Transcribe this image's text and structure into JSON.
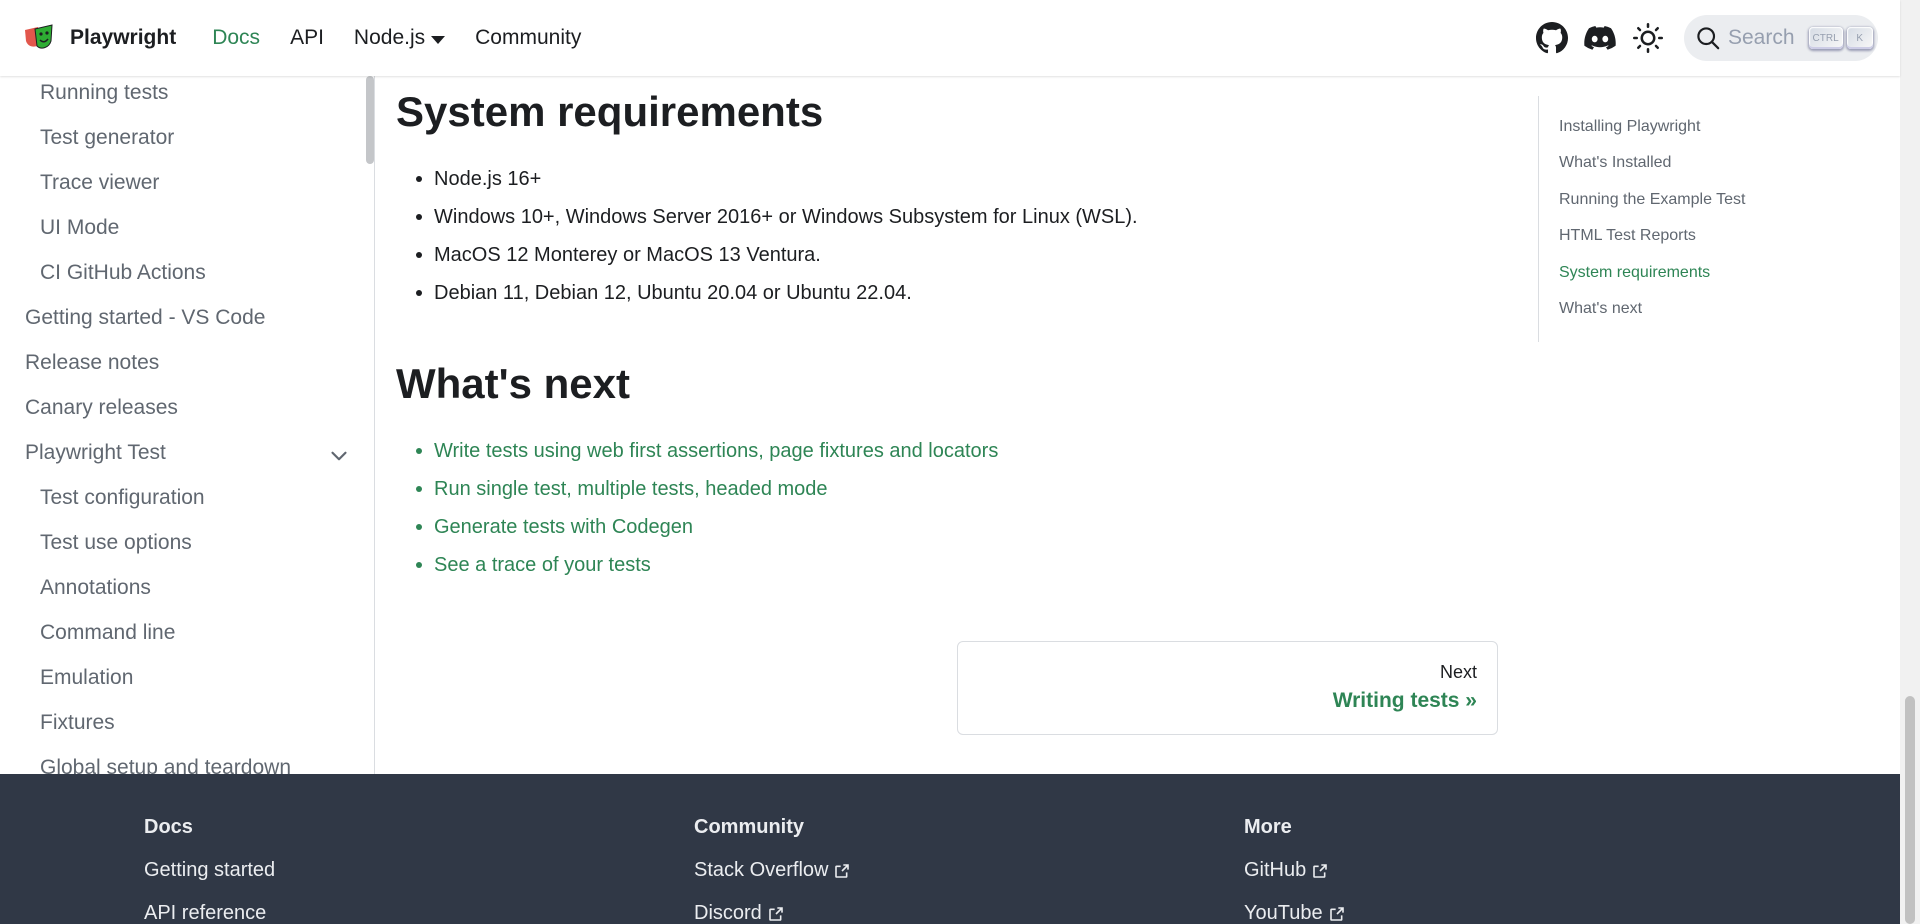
{
  "navbar": {
    "brand": "Playwright",
    "links": [
      "Docs",
      "API",
      "Node.js",
      "Community"
    ],
    "search_placeholder": "Search",
    "kbd_ctrl": "CTRL",
    "kbd_k": "K"
  },
  "sidebar": {
    "items": [
      "Running tests",
      "Test generator",
      "Trace viewer",
      "UI Mode",
      "CI GitHub Actions",
      "Getting started - VS Code",
      "Release notes",
      "Canary releases",
      "Playwright Test",
      "Test configuration",
      "Test use options",
      "Annotations",
      "Command line",
      "Emulation",
      "Fixtures",
      "Global setup and teardown"
    ]
  },
  "main": {
    "sys_title": "System requirements",
    "sys_items": [
      "Node.js 16+",
      "Windows 10+, Windows Server 2016+ or Windows Subsystem for Linux (WSL).",
      "MacOS 12 Monterey or MacOS 13 Ventura.",
      "Debian 11, Debian 12, Ubuntu 20.04 or Ubuntu 22.04."
    ],
    "next_title": "What's next",
    "next_items": [
      "Write tests using web first assertions, page fixtures and locators",
      "Run single test, multiple tests, headed mode",
      "Generate tests with Codegen",
      "See a trace of your tests"
    ],
    "pager_sub": "Next",
    "pager_label": "Writing tests »"
  },
  "toc": {
    "items": [
      "Installing Playwright",
      "What's Installed",
      "Running the Example Test",
      "HTML Test Reports",
      "System requirements",
      "What's next"
    ]
  },
  "footer": {
    "docs_title": "Docs",
    "docs_links": [
      "Getting started",
      "API reference"
    ],
    "community_title": "Community",
    "community_links": [
      "Stack Overflow",
      "Discord"
    ],
    "more_title": "More",
    "more_links": [
      "GitHub",
      "YouTube"
    ]
  },
  "colors": {
    "accent": "#2e8555",
    "footer_bg": "#303846"
  }
}
